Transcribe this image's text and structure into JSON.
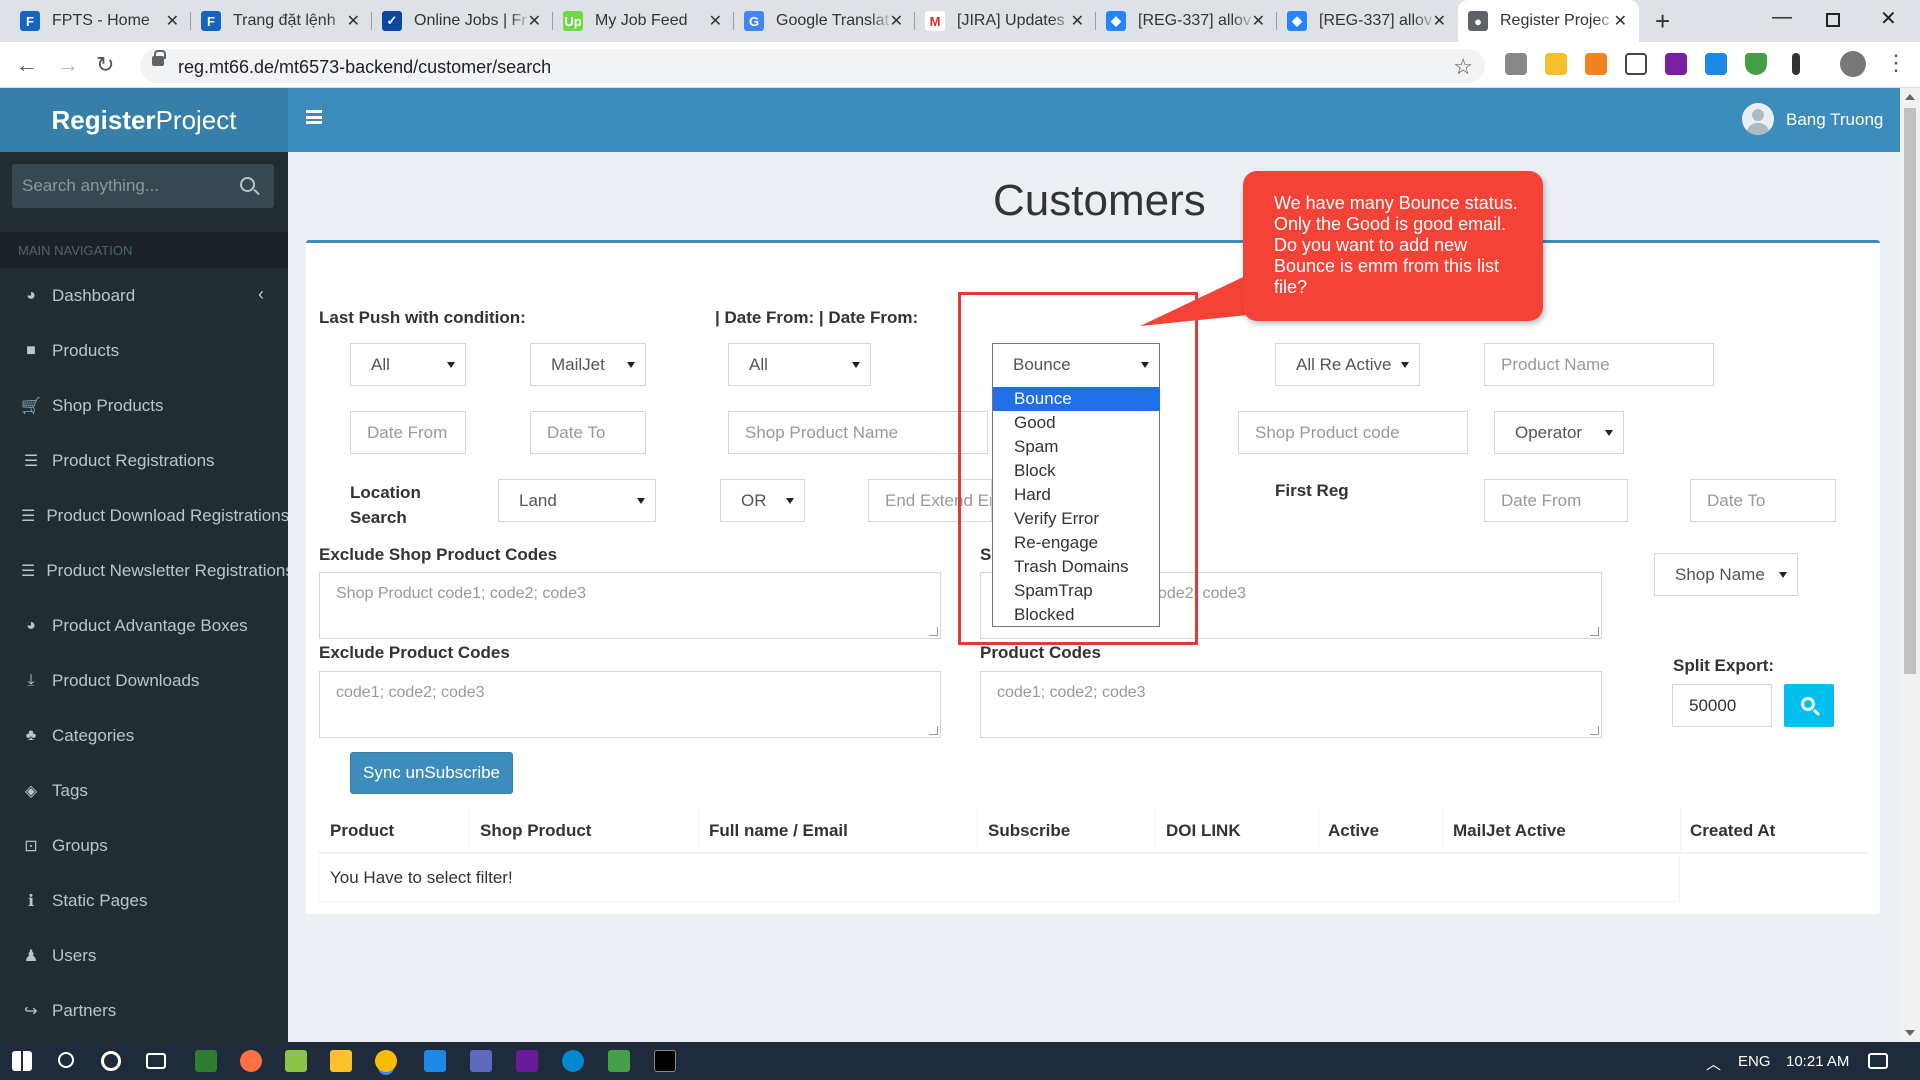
{
  "browser": {
    "tabs": [
      {
        "label": "FPTS - Home",
        "icon": "fpts-icon",
        "color": "#1565c0",
        "glyph": "F"
      },
      {
        "label": "Trang đặt lệnh",
        "icon": "fpts-icon",
        "color": "#1565c0",
        "glyph": "F"
      },
      {
        "label": "Online Jobs | Fr",
        "icon": "freelancer-icon",
        "color": "#0d47a1",
        "glyph": "✓"
      },
      {
        "label": "My Job Feed",
        "icon": "upwork-icon",
        "color": "#6fda44",
        "glyph": "Up"
      },
      {
        "label": "Google Translat",
        "icon": "google-translate-icon",
        "color": "#4285f4",
        "glyph": "G"
      },
      {
        "label": "[JIRA] Updates",
        "icon": "gmail-icon",
        "color": "#ffffff",
        "glyph": "M"
      },
      {
        "label": "[REG-337] allov",
        "icon": "jira-icon",
        "color": "#2684ff",
        "glyph": "◆"
      },
      {
        "label": "[REG-337] allov",
        "icon": "jira-icon",
        "color": "#2684ff",
        "glyph": "◆"
      },
      {
        "label": "Register Projec",
        "icon": "globe-icon",
        "color": "#5f6368",
        "glyph": "●"
      }
    ],
    "url": "reg.mt66.de/mt6573-backend/customer/search"
  },
  "app": {
    "logo_bold": "Register",
    "logo_rest": "Project",
    "user_name": "Bang Truong"
  },
  "sidebar": {
    "search_placeholder": "Search anything...",
    "header": "MAIN NAVIGATION",
    "items": [
      {
        "label": "Dashboard",
        "icon": "dashboard-icon",
        "glyph": "◕"
      },
      {
        "label": "Products",
        "icon": "products-icon",
        "glyph": "■"
      },
      {
        "label": "Shop Products",
        "icon": "cart-icon",
        "glyph": "🛒"
      },
      {
        "label": "Product Registrations",
        "icon": "list-icon",
        "glyph": "☰"
      },
      {
        "label": "Product Download Registrations",
        "icon": "list-icon",
        "glyph": "☰"
      },
      {
        "label": "Product Newsletter Registrations",
        "icon": "list-icon",
        "glyph": "☰"
      },
      {
        "label": "Product Advantage Boxes",
        "icon": "dashboard-icon",
        "glyph": "◕"
      },
      {
        "label": "Product Downloads",
        "icon": "download-icon",
        "glyph": "⤓"
      },
      {
        "label": "Categories",
        "icon": "sitemap-icon",
        "glyph": "♣"
      },
      {
        "label": "Tags",
        "icon": "tags-icon",
        "glyph": "◈"
      },
      {
        "label": "Groups",
        "icon": "groups-icon",
        "glyph": "⊡"
      },
      {
        "label": "Static Pages",
        "icon": "info-icon",
        "glyph": "ℹ"
      },
      {
        "label": "Users",
        "icon": "user-icon",
        "glyph": "♟"
      },
      {
        "label": "Partners",
        "icon": "share-icon",
        "glyph": "↪"
      }
    ]
  },
  "page": {
    "title": "Customers",
    "last_push_label": "Last Push with condition:",
    "date_from_label": "| Date From: | Date From:",
    "sel_all_1": "All",
    "sel_mailjet": "MailJet",
    "sel_all_2": "All",
    "sel_status": "Bounce",
    "sel_re_active": "All Re Active",
    "product_name_ph": "Product Name",
    "date_from_ph": "Date From",
    "date_to_ph": "Date To",
    "shop_product_name_ph": "Shop Product Name",
    "shop_product_code_ph": "Shop Product code",
    "sel_operator": "Operator",
    "location_search_label": "Location\nSearch",
    "sel_land": "Land",
    "sel_or": "OR",
    "end_extend_ph": "End Extend Em",
    "first_reg_label": "First Reg",
    "first_reg_from_ph": "Date From",
    "first_reg_to_ph": "Date To",
    "exclude_shop_codes_label": "Exclude Shop Product Codes",
    "exclude_shop_codes_ph": "Shop Product code1; code2; code3",
    "shop_codes_label_partial": "Sh",
    "shop_codes_ph_partial": "ode2; code3",
    "sel_shop_name": "Shop Name",
    "exclude_product_codes_label": "Exclude Product Codes",
    "exclude_product_codes_ph": "code1; code2; code3",
    "product_codes_label": "Product Codes",
    "product_codes_ph": "code1; code2; code3",
    "split_export_label": "Split Export:",
    "split_export_value": "50000",
    "sync_button": "Sync unSubscribe",
    "table_headers": [
      "Product",
      "Shop Product",
      "Full name / Email",
      "Subscribe",
      "DOI LINK",
      "Active",
      "MailJet Active",
      "Created At"
    ],
    "empty_message": "You Have to select filter!"
  },
  "dropdown": {
    "options": [
      "Bounce",
      "Good",
      "Spam",
      "Block",
      "Hard",
      "Verify Error",
      "Re-engage",
      "Trash Domains",
      "SpamTrap",
      "Blocked"
    ],
    "selected_index": 0
  },
  "annotation": {
    "text": "We have many Bounce status. Only the Good is good email. Do you want to add new Bounce is emm from this list file?",
    "color": "#f44336"
  },
  "taskbar": {
    "lang": "ENG",
    "time": "10:21 AM"
  },
  "colors": {
    "header_blue": "#3c8dbc",
    "logo_blue": "#367fa9",
    "sidebar_dark": "#222d32",
    "search_cyan": "#00c0ef",
    "selected_option": "#1e6fe8"
  }
}
